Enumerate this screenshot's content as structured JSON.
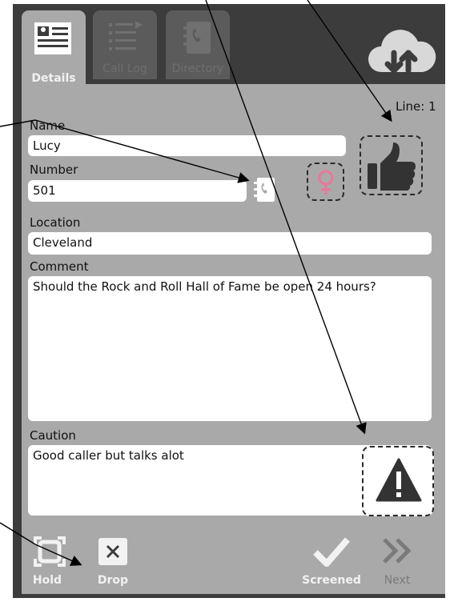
{
  "tabs": [
    {
      "label": "Details",
      "icon": "contact-card-icon",
      "active": true
    },
    {
      "label": "Call Log",
      "icon": "call-log-icon",
      "active": false
    },
    {
      "label": "Directory",
      "icon": "directory-icon",
      "active": false
    }
  ],
  "header": {
    "cloud_icon": "cloud-sync-icon"
  },
  "details": {
    "line_label": "Line: 1",
    "name_label": "Name",
    "name_value": "Lucy",
    "number_label": "Number",
    "number_value": "501",
    "location_label": "Location",
    "location_value": "Cleveland",
    "comment_label": "Comment",
    "comment_value": "Should the Rock and Roll Hall of Fame be open 24 hours?",
    "caution_label": "Caution",
    "caution_value": "Good caller but talks alot"
  },
  "icons": {
    "directory_lookup": "phonebook-icon",
    "gender": "female-icon",
    "rating": "thumbs-up-icon",
    "caution": "warning-icon"
  },
  "bottom_bar": {
    "hold_label": "Hold",
    "drop_label": "Drop",
    "screened_label": "Screened",
    "next_label": "Next"
  },
  "colors": {
    "panel": "#a9a9a9",
    "frame": "#3c3c3c",
    "female_icon": "#e8789a"
  }
}
